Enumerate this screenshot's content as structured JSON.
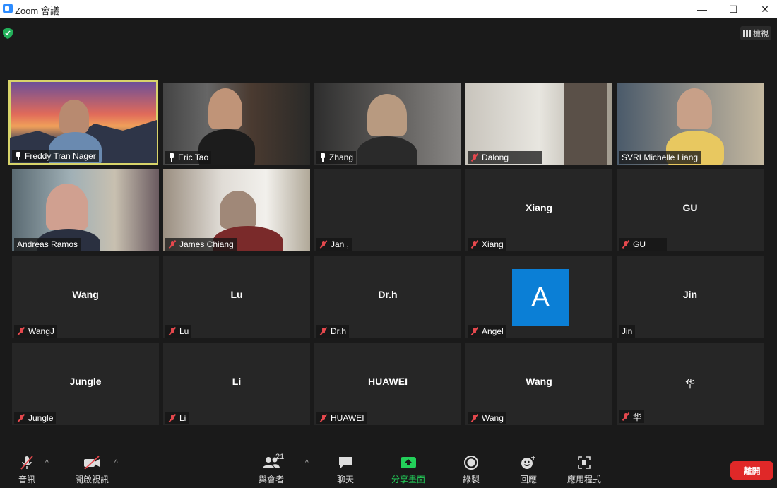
{
  "window": {
    "title": "Zoom 會議",
    "minimize": "—",
    "maximize": "☐",
    "close": "✕"
  },
  "view_button": {
    "label": "檢視"
  },
  "tiles": [
    {
      "name": "Freddy Tran Nager",
      "center": "",
      "muted": false,
      "pinned": true
    },
    {
      "name": "Eric Tao",
      "center": "",
      "muted": false,
      "pinned": true
    },
    {
      "name": "Zhang",
      "center": "",
      "muted": false,
      "pinned": true
    },
    {
      "name": "Dalong",
      "center": "",
      "muted": true,
      "pinned": false
    },
    {
      "name": "SVRI Michelle Liang",
      "center": "",
      "muted": false,
      "pinned": false
    },
    {
      "name": "Andreas Ramos",
      "center": "",
      "muted": false,
      "pinned": false
    },
    {
      "name": "James Chiang",
      "center": "",
      "muted": true,
      "pinned": false
    },
    {
      "name": "Jan ,",
      "center": "",
      "muted": true,
      "pinned": false
    },
    {
      "name": "Xiang",
      "center": "Xiang",
      "muted": true,
      "pinned": false
    },
    {
      "name": "GU",
      "center": "GU",
      "muted": true,
      "pinned": false
    },
    {
      "name": "WangJ",
      "center": "Wang",
      "muted": true,
      "pinned": false
    },
    {
      "name": "Lu",
      "center": "Lu",
      "muted": true,
      "pinned": false
    },
    {
      "name": "Dr.h",
      "center": "Dr.h",
      "muted": true,
      "pinned": false
    },
    {
      "name": "Angel",
      "center": "",
      "avatar_letter": "A",
      "muted": true,
      "pinned": false
    },
    {
      "name": "Jin",
      "center": "Jin",
      "muted": false,
      "pinned": false
    },
    {
      "name": "Jungle",
      "center": "Jungle",
      "muted": true,
      "pinned": false
    },
    {
      "name": "Li",
      "center": "Li",
      "muted": true,
      "pinned": false
    },
    {
      "name": "HUAWEI",
      "center": "HUAWEI",
      "muted": true,
      "pinned": false
    },
    {
      "name": "Wang",
      "center": "Wang",
      "muted": true,
      "pinned": false
    },
    {
      "name": "华",
      "center": "华",
      "muted": true,
      "pinned": false
    }
  ],
  "toolbar": {
    "audio": "音訊",
    "video": "開啟視訊",
    "participants": "與會者",
    "participants_count": "21",
    "chat": "聊天",
    "share": "分享畫面",
    "record": "錄製",
    "reactions": "回應",
    "apps": "應用程式",
    "leave": "離開"
  },
  "colors": {
    "active_speaker": "#d8d46a",
    "share_green": "#23d05a",
    "leave_red": "#e02828",
    "avatar_blue": "#0b7fd6"
  }
}
